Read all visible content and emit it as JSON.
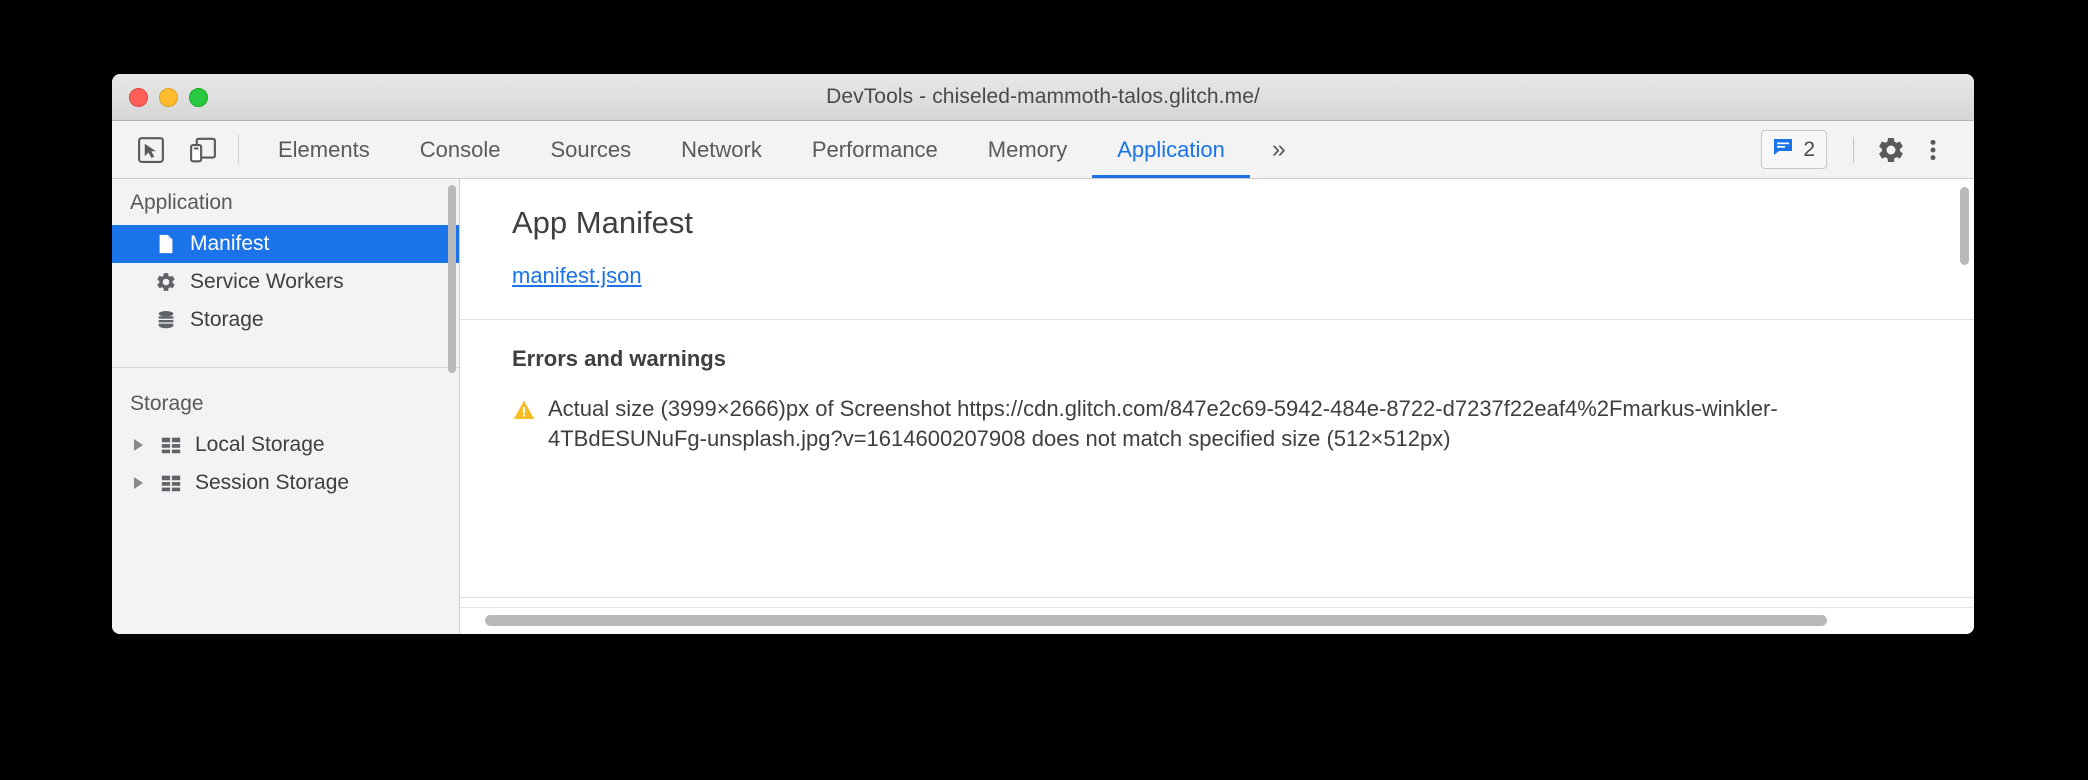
{
  "window": {
    "title": "DevTools - chiseled-mammoth-talos.glitch.me/",
    "traffic_lights": [
      "close-button",
      "minimize-button",
      "zoom-button"
    ]
  },
  "toolbar": {
    "inspect_icon": "inspect-element-icon",
    "device_icon": "device-toolbar-icon",
    "tabs": [
      {
        "label": "Elements",
        "selected": false
      },
      {
        "label": "Console",
        "selected": false
      },
      {
        "label": "Sources",
        "selected": false
      },
      {
        "label": "Network",
        "selected": false
      },
      {
        "label": "Performance",
        "selected": false
      },
      {
        "label": "Memory",
        "selected": false
      },
      {
        "label": "Application",
        "selected": true
      }
    ],
    "overflow_label": "»",
    "issues": {
      "icon": "message-icon",
      "count": "2",
      "accent": "#1a73e8"
    },
    "settings_icon": "gear-icon",
    "more_icon": "kebab-menu-icon"
  },
  "sidebar": {
    "groups": [
      {
        "title": "Application",
        "items": [
          {
            "label": "Manifest",
            "icon": "document-icon",
            "selected": true,
            "expandable": false
          },
          {
            "label": "Service Workers",
            "icon": "gear-icon",
            "selected": false,
            "expandable": false
          },
          {
            "label": "Storage",
            "icon": "database-icon",
            "selected": false,
            "expandable": false
          }
        ]
      },
      {
        "title": "Storage",
        "items": [
          {
            "label": "Local Storage",
            "icon": "table-icon",
            "selected": false,
            "expandable": true
          },
          {
            "label": "Session Storage",
            "icon": "table-icon",
            "selected": false,
            "expandable": true
          }
        ]
      }
    ],
    "selected_color": "#1a73e8"
  },
  "main": {
    "heading": "App Manifest",
    "manifest_link": "manifest.json",
    "errors_heading": "Errors and warnings",
    "warning_icon": "warning-triangle-icon",
    "warning_text": "Actual size (3999×2666)px of Screenshot https://cdn.glitch.com/847e2c69-5942-484e-8722-d7237f22eaf4%2Fmarkus-winkler-4TBdESUNuFg-unsplash.jpg?v=1614600207908 does not match specified size (512×512px)"
  }
}
